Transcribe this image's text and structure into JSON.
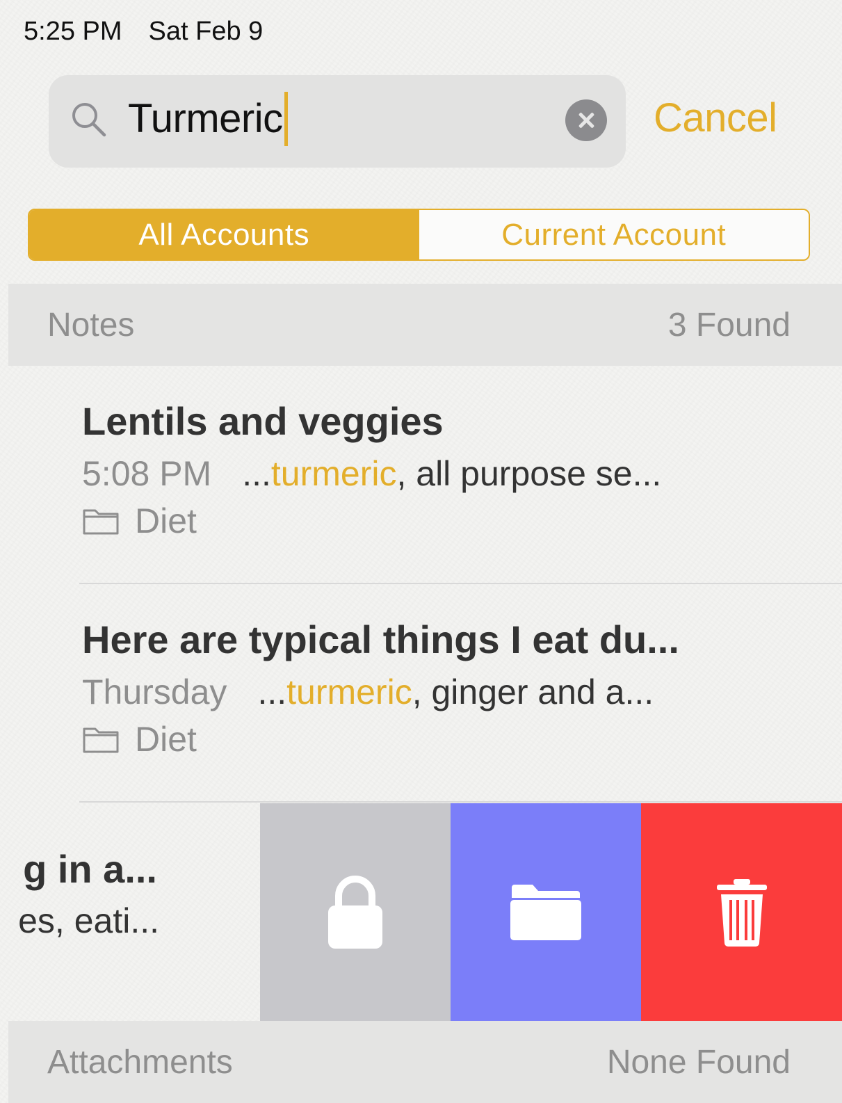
{
  "status_bar": {
    "time": "5:25 PM",
    "date": "Sat Feb 9"
  },
  "search": {
    "query": "Turmeric",
    "cancel_label": "Cancel",
    "icon": "search-icon",
    "clear_icon": "clear-icon"
  },
  "scope": {
    "options": [
      "All Accounts",
      "Current Account"
    ],
    "selected": "All Accounts"
  },
  "notes_section": {
    "label": "Notes",
    "count": "3 Found"
  },
  "results": [
    {
      "title": "Lentils and veggies",
      "date": "5:08 PM",
      "snippet_prefix": "...",
      "match": "turmeric",
      "snippet_suffix": ", all purpose se...",
      "folder": "Diet"
    },
    {
      "title": "Here are typical things I eat du...",
      "date": "Thursday",
      "snippet_prefix": "...",
      "match": "turmeric",
      "snippet_suffix": ", ginger and a...",
      "folder": "Diet"
    },
    {
      "title_visible": "g in a...",
      "snippet_visible": "es, eati..."
    }
  ],
  "swipe_actions": [
    {
      "icon": "lock-icon",
      "color": "#c7c7cb"
    },
    {
      "icon": "folder-icon",
      "color": "#7b7ef9"
    },
    {
      "icon": "trash-icon",
      "color": "#fb3c3c"
    }
  ],
  "attachments_section": {
    "label": "Attachments",
    "count": "None Found"
  },
  "colors": {
    "accent": "#e3ae2b",
    "destructive": "#fb3c3c",
    "move": "#7b7ef9",
    "lock": "#c7c7cb"
  }
}
